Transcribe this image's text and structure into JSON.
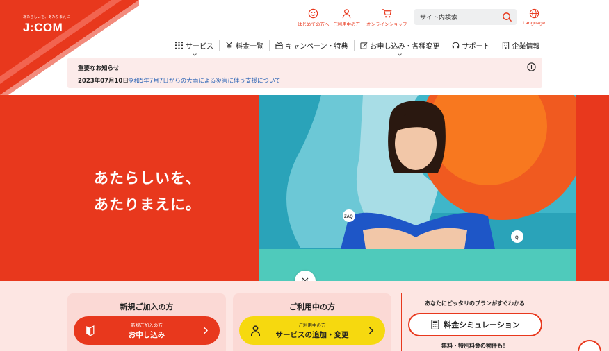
{
  "brand": {
    "tagline": "あたらしいを、あたりまえに",
    "logo": "J:COM",
    "accent": "#e8381d"
  },
  "utility": {
    "first_time": "はじめての方へ",
    "current_users": "ご利用中の方",
    "online_shop": "オンラインショップ",
    "language": "Language"
  },
  "search": {
    "placeholder": "サイト内検索"
  },
  "nav": {
    "items": [
      {
        "label": "サービス",
        "icon": "grid-icon"
      },
      {
        "label": "料金一覧",
        "icon": "yen-icon"
      },
      {
        "label": "キャンペーン・特典",
        "icon": "gift-icon"
      },
      {
        "label": "お申し込み・各種変更",
        "icon": "edit-icon"
      },
      {
        "label": "サポート",
        "icon": "headset-icon"
      },
      {
        "label": "企業情報",
        "icon": "building-icon"
      }
    ]
  },
  "notice": {
    "title": "重要なお知らせ",
    "date": "2023年07月10日",
    "link": "令和5年7月7日からの大雨による災害に伴う支援について"
  },
  "hero": {
    "line1": "あたらしいを、",
    "line2": "あたりまえに。",
    "mascot_left": "ZAQ",
    "mascot_right": "Q"
  },
  "new_customer": {
    "title": "新規ご加入の方",
    "small": "新規ご加入の方",
    "big": "お申し込み",
    "color": "#e8381d"
  },
  "existing_customer": {
    "title": "ご利用中の方",
    "small": "ご利用中の方",
    "big": "サービスの追加・変更",
    "color": "#f6d90f"
  },
  "simulation": {
    "lead": "あなたにピッタリのプランがすぐわかる",
    "button": "料金シミュレーション",
    "note": "無料・特別料金の物件も！"
  }
}
